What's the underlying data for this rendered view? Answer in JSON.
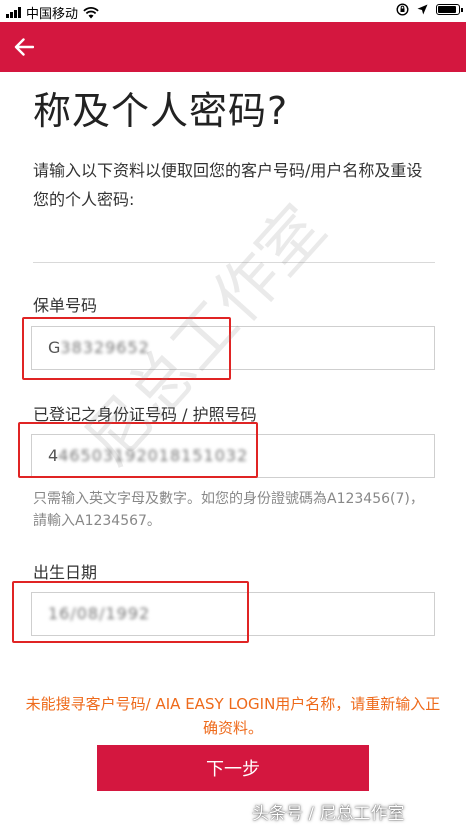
{
  "status_bar": {
    "carrier": "中国移动",
    "battery_level": 0.9
  },
  "header": {
    "back_icon": "arrow-left-icon",
    "color": "#d4173f"
  },
  "page": {
    "title": "称及个人密码?",
    "instruction": "请输入以下资料以便取回您的客户号码/用户名称及重设您的个人密码:"
  },
  "form": {
    "policy_number": {
      "label": "保单号码",
      "value_prefix": "G",
      "value_obscured": "38329652"
    },
    "id_number": {
      "label": "已登记之身份证号码 / 护照号码",
      "value_prefix": "4",
      "value_obscured": "46503192018151032"
    },
    "id_hint": "只需输入英文字母及數字。如您的身份證號碼為A123456(7)，請輸入A1234567。",
    "birth_date": {
      "label": "出生日期",
      "value_obscured": "16/08/1992"
    }
  },
  "error_message": "未能搜寻客户号码/ AIA EASY LOGIN用户名称，请重新输入正确资料。",
  "next_button_label": "下一步",
  "watermark": "头条号 / 尼总工作室",
  "diagonal_watermark": "尼总工作室"
}
